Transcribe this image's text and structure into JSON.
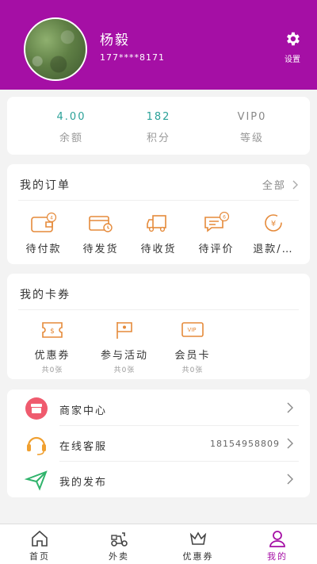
{
  "profile": {
    "name": "杨毅",
    "phone": "177****8171",
    "settings_label": "设置"
  },
  "stats": [
    {
      "value": "4.00",
      "label": "余额"
    },
    {
      "value": "182",
      "label": "积分"
    },
    {
      "value": "VIP0",
      "label": "等级"
    }
  ],
  "orders": {
    "title": "我的订单",
    "all_label": "全部",
    "items": [
      {
        "label": "待付款",
        "icon": "wallet-icon"
      },
      {
        "label": "待发货",
        "icon": "card-clock-icon"
      },
      {
        "label": "待收货",
        "icon": "truck-icon"
      },
      {
        "label": "待评价",
        "icon": "comment-icon"
      },
      {
        "label": "退款/…",
        "icon": "refund-icon"
      }
    ]
  },
  "coupons": {
    "title": "我的卡券",
    "items": [
      {
        "label": "优惠券",
        "count": "共0张",
        "icon": "coupon-icon"
      },
      {
        "label": "参与活动",
        "count": "共0张",
        "icon": "flag-icon"
      },
      {
        "label": "会员卡",
        "count": "共0张",
        "icon": "vip-card-icon"
      }
    ]
  },
  "menu": [
    {
      "label": "商家中心",
      "value": "",
      "icon": "store-icon"
    },
    {
      "label": "在线客服",
      "value": "18154958809",
      "icon": "headset-icon"
    },
    {
      "label": "我的发布",
      "value": "",
      "icon": "paper-plane-icon"
    }
  ],
  "tabs": [
    {
      "label": "首页",
      "icon": "home-icon"
    },
    {
      "label": "外卖",
      "icon": "scooter-icon"
    },
    {
      "label": "优惠券",
      "icon": "crown-icon"
    },
    {
      "label": "我的",
      "icon": "user-icon"
    }
  ],
  "colors": {
    "brand": "#a50fa5",
    "accent": "#2aa198",
    "icon_orange": "#e58a3a",
    "store_red": "#ef5b6e",
    "headset_orange": "#f0a030",
    "plane_green": "#2fb36b"
  }
}
